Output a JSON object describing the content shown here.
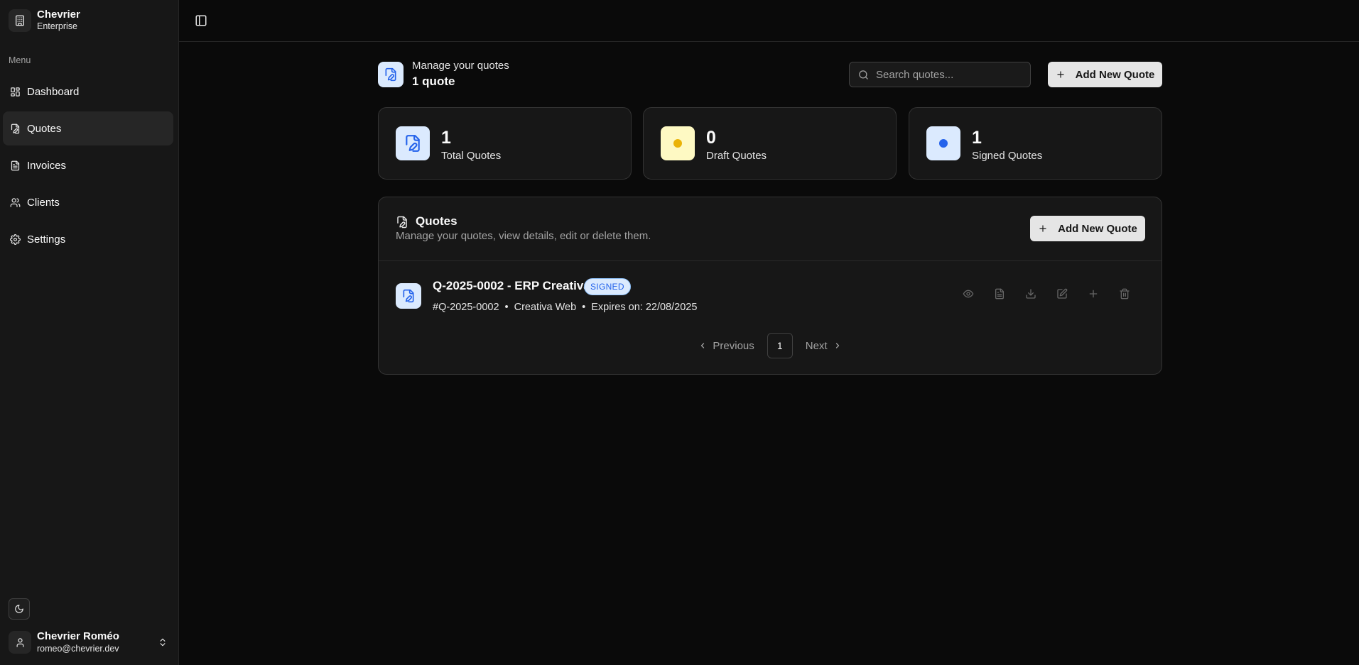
{
  "brand": {
    "name": "Chevrier",
    "subtitle": "Enterprise",
    "logo_icon": "building-icon"
  },
  "sidebar": {
    "menu_label": "Menu",
    "items": [
      {
        "label": "Dashboard",
        "icon": "layout-grid-icon",
        "active": false
      },
      {
        "label": "Quotes",
        "icon": "file-pen-icon",
        "active": true
      },
      {
        "label": "Invoices",
        "icon": "file-text-icon",
        "active": false
      },
      {
        "label": "Clients",
        "icon": "users-icon",
        "active": false
      },
      {
        "label": "Settings",
        "icon": "gear-icon",
        "active": false
      }
    ]
  },
  "user": {
    "name": "Chevrier Roméo",
    "email": "romeo@chevrier.dev"
  },
  "header": {
    "subtitle": "Manage your quotes",
    "count": "1 quote",
    "search_placeholder": "Search quotes...",
    "add_button": "Add New Quote"
  },
  "stats": [
    {
      "value": "1",
      "label": "Total Quotes",
      "icon": "file-pen-icon",
      "bg": "#dbeafe"
    },
    {
      "value": "0",
      "label": "Draft Quotes",
      "icon": "dot-icon",
      "bg": "#fef9c3",
      "dot": "#eab308"
    },
    {
      "value": "1",
      "label": "Signed Quotes",
      "icon": "dot-icon",
      "bg": "#dbeafe",
      "dot": "#2563eb"
    }
  ],
  "panel": {
    "title": "Quotes",
    "description": "Manage your quotes, view details, edit or delete them.",
    "add_button": "Add New Quote"
  },
  "quotes": [
    {
      "title": "Q-2025-0002 - ERP Creativa",
      "status": "SIGNED",
      "number": "#Q-2025-0002",
      "client": "Creativa Web",
      "expires": "Expires on: 22/08/2025"
    }
  ],
  "pagination": {
    "previous": "Previous",
    "page": "1",
    "next": "Next"
  },
  "colors": {
    "accent": "#2563eb",
    "background": "#0a0a0a",
    "surface": "#171717"
  }
}
